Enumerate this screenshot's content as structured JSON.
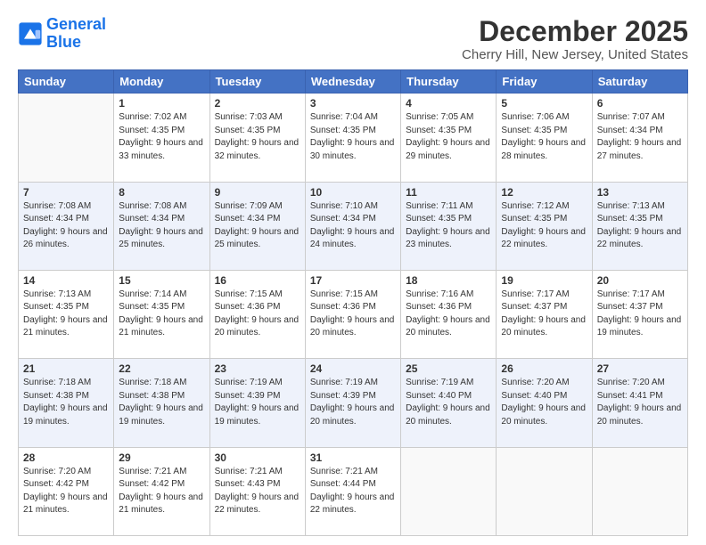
{
  "logo": {
    "line1": "General",
    "line2": "Blue"
  },
  "title": "December 2025",
  "subtitle": "Cherry Hill, New Jersey, United States",
  "weekdays": [
    "Sunday",
    "Monday",
    "Tuesday",
    "Wednesday",
    "Thursday",
    "Friday",
    "Saturday"
  ],
  "weeks": [
    [
      {
        "day": "",
        "sunrise": "",
        "sunset": "",
        "daylight": ""
      },
      {
        "day": "1",
        "sunrise": "7:02 AM",
        "sunset": "4:35 PM",
        "daylight": "9 hours and 33 minutes."
      },
      {
        "day": "2",
        "sunrise": "7:03 AM",
        "sunset": "4:35 PM",
        "daylight": "9 hours and 32 minutes."
      },
      {
        "day": "3",
        "sunrise": "7:04 AM",
        "sunset": "4:35 PM",
        "daylight": "9 hours and 30 minutes."
      },
      {
        "day": "4",
        "sunrise": "7:05 AM",
        "sunset": "4:35 PM",
        "daylight": "9 hours and 29 minutes."
      },
      {
        "day": "5",
        "sunrise": "7:06 AM",
        "sunset": "4:35 PM",
        "daylight": "9 hours and 28 minutes."
      },
      {
        "day": "6",
        "sunrise": "7:07 AM",
        "sunset": "4:34 PM",
        "daylight": "9 hours and 27 minutes."
      }
    ],
    [
      {
        "day": "7",
        "sunrise": "7:08 AM",
        "sunset": "4:34 PM",
        "daylight": "9 hours and 26 minutes."
      },
      {
        "day": "8",
        "sunrise": "7:08 AM",
        "sunset": "4:34 PM",
        "daylight": "9 hours and 25 minutes."
      },
      {
        "day": "9",
        "sunrise": "7:09 AM",
        "sunset": "4:34 PM",
        "daylight": "9 hours and 25 minutes."
      },
      {
        "day": "10",
        "sunrise": "7:10 AM",
        "sunset": "4:34 PM",
        "daylight": "9 hours and 24 minutes."
      },
      {
        "day": "11",
        "sunrise": "7:11 AM",
        "sunset": "4:35 PM",
        "daylight": "9 hours and 23 minutes."
      },
      {
        "day": "12",
        "sunrise": "7:12 AM",
        "sunset": "4:35 PM",
        "daylight": "9 hours and 22 minutes."
      },
      {
        "day": "13",
        "sunrise": "7:13 AM",
        "sunset": "4:35 PM",
        "daylight": "9 hours and 22 minutes."
      }
    ],
    [
      {
        "day": "14",
        "sunrise": "7:13 AM",
        "sunset": "4:35 PM",
        "daylight": "9 hours and 21 minutes."
      },
      {
        "day": "15",
        "sunrise": "7:14 AM",
        "sunset": "4:35 PM",
        "daylight": "9 hours and 21 minutes."
      },
      {
        "day": "16",
        "sunrise": "7:15 AM",
        "sunset": "4:36 PM",
        "daylight": "9 hours and 20 minutes."
      },
      {
        "day": "17",
        "sunrise": "7:15 AM",
        "sunset": "4:36 PM",
        "daylight": "9 hours and 20 minutes."
      },
      {
        "day": "18",
        "sunrise": "7:16 AM",
        "sunset": "4:36 PM",
        "daylight": "9 hours and 20 minutes."
      },
      {
        "day": "19",
        "sunrise": "7:17 AM",
        "sunset": "4:37 PM",
        "daylight": "9 hours and 20 minutes."
      },
      {
        "day": "20",
        "sunrise": "7:17 AM",
        "sunset": "4:37 PM",
        "daylight": "9 hours and 19 minutes."
      }
    ],
    [
      {
        "day": "21",
        "sunrise": "7:18 AM",
        "sunset": "4:38 PM",
        "daylight": "9 hours and 19 minutes."
      },
      {
        "day": "22",
        "sunrise": "7:18 AM",
        "sunset": "4:38 PM",
        "daylight": "9 hours and 19 minutes."
      },
      {
        "day": "23",
        "sunrise": "7:19 AM",
        "sunset": "4:39 PM",
        "daylight": "9 hours and 19 minutes."
      },
      {
        "day": "24",
        "sunrise": "7:19 AM",
        "sunset": "4:39 PM",
        "daylight": "9 hours and 20 minutes."
      },
      {
        "day": "25",
        "sunrise": "7:19 AM",
        "sunset": "4:40 PM",
        "daylight": "9 hours and 20 minutes."
      },
      {
        "day": "26",
        "sunrise": "7:20 AM",
        "sunset": "4:40 PM",
        "daylight": "9 hours and 20 minutes."
      },
      {
        "day": "27",
        "sunrise": "7:20 AM",
        "sunset": "4:41 PM",
        "daylight": "9 hours and 20 minutes."
      }
    ],
    [
      {
        "day": "28",
        "sunrise": "7:20 AM",
        "sunset": "4:42 PM",
        "daylight": "9 hours and 21 minutes."
      },
      {
        "day": "29",
        "sunrise": "7:21 AM",
        "sunset": "4:42 PM",
        "daylight": "9 hours and 21 minutes."
      },
      {
        "day": "30",
        "sunrise": "7:21 AM",
        "sunset": "4:43 PM",
        "daylight": "9 hours and 22 minutes."
      },
      {
        "day": "31",
        "sunrise": "7:21 AM",
        "sunset": "4:44 PM",
        "daylight": "9 hours and 22 minutes."
      },
      {
        "day": "",
        "sunrise": "",
        "sunset": "",
        "daylight": ""
      },
      {
        "day": "",
        "sunrise": "",
        "sunset": "",
        "daylight": ""
      },
      {
        "day": "",
        "sunrise": "",
        "sunset": "",
        "daylight": ""
      }
    ]
  ],
  "labels": {
    "sunrise_prefix": "Sunrise: ",
    "sunset_prefix": "Sunset: ",
    "daylight_prefix": "Daylight: "
  }
}
